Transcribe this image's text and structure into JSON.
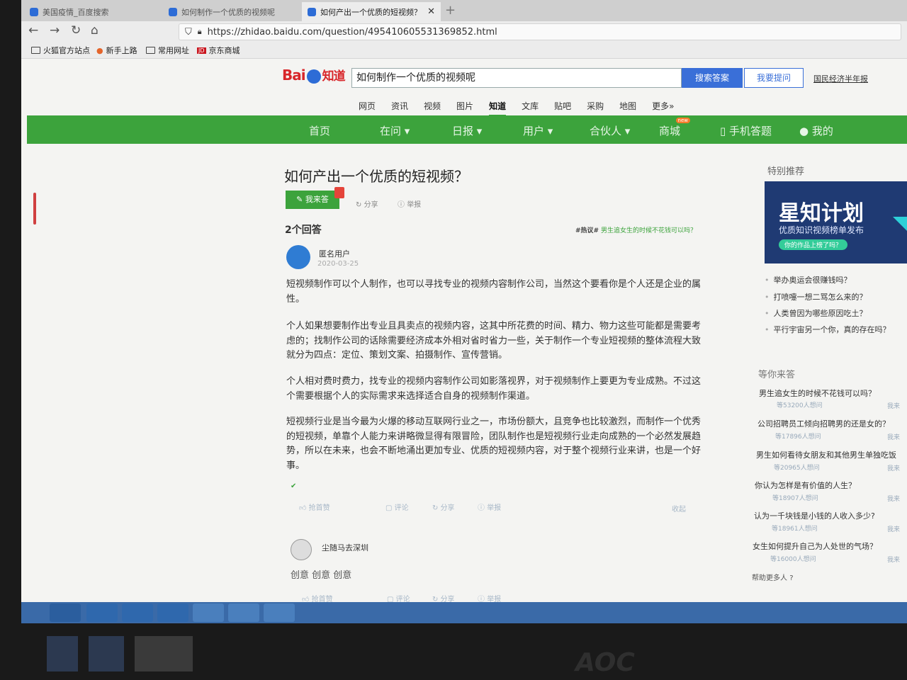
{
  "browser": {
    "tabs": [
      {
        "label": "美国疫情_百度搜索"
      },
      {
        "label": "如何制作一个优质的视频呢"
      },
      {
        "label": "如何产出一个优质的短视频？"
      }
    ],
    "new_tab": "+",
    "close_glyph": "✕",
    "url": "https://zhidao.baidu.com/question/495410605531369852.html",
    "bookmarks": [
      "火狐官方站点",
      "新手上路",
      "常用网址",
      "京东商城"
    ]
  },
  "header": {
    "logo": {
      "bai": "Bai",
      "du": "du",
      "zhidao": "知道"
    },
    "search_value": "如何制作一个优质的视频呢",
    "search_button": "搜索答案",
    "ask_button": "我要提问",
    "annual_link": "国民经济半年报",
    "categories": [
      "网页",
      "资讯",
      "视频",
      "图片",
      "知道",
      "文库",
      "贴吧",
      "采购",
      "地图",
      "更多»"
    ],
    "active_category": "知道"
  },
  "greennav": {
    "items": [
      "首页",
      "在问 ▾",
      "日报 ▾",
      "用户 ▾",
      "合伙人 ▾",
      "商城",
      "手机答题",
      "我的"
    ],
    "new_badge": "new"
  },
  "question": {
    "title": "如何产出一个优质的短视频？",
    "answer_button": "我来答",
    "share": "分享",
    "report": "举报",
    "answer_count": "2个回答",
    "hot_tag": "#热议#",
    "hot_question": "男生追女生的时候不花钱可以吗？"
  },
  "answer1": {
    "user": "匿名用户",
    "date": "2020-03-25",
    "paragraphs": [
      "短视频制作可以个人制作，也可以寻找专业的视频内容制作公司，当然这个要看你是个人还是企业的属性。",
      "个人如果想要制作出专业且具卖点的视频内容，这其中所花费的时间、精力、物力这些可能都是需要考虑的；找制作公司的话除需要经济成本外相对省时省力一些，关于制作一个专业短视频的整体流程大致就分为四点：定位、策划文案、拍摄制作、宣传营销。",
      "个人相对费时费力，找专业的视频内容制作公司如影落视界，对于视频制作上要更为专业成熟。不过这个需要根据个人的实际需求来选择适合自身的视频制作渠道。",
      "短视频行业是当今最为火爆的移动互联网行业之一，市场份额大，且竞争也比较激烈，而制作一个优秀的短视频，单靠个人能力来讲略微显得有限冒险，团队制作也是短视频行业走向成熟的一个必然发展趋势，所以在未来，也会不断地涌出更加专业、优质的短视频内容，对于整个视频行业来讲，也是一个好事。"
    ],
    "actions": [
      "抢首赞",
      "评论",
      "分享",
      "举报"
    ],
    "collect": "收起"
  },
  "answer2": {
    "user": "尘随马去深圳",
    "body": "创意 创意 创意",
    "actions": [
      "抢首赞",
      "评论",
      "分享",
      "举报"
    ]
  },
  "sidebar": {
    "title": "特别推荐",
    "banner": {
      "title": "星知计划",
      "subtitle": "优质知识视频榜单发布",
      "pill": "你的作品上榜了吗？"
    },
    "recommend": [
      "举办奥运会很赚钱吗？",
      "打喷嚏一想二骂怎么来的？",
      "人类曾因为哪些原因吃土？",
      "平行宇宙另一个你，真的存在吗？"
    ],
    "waiting_title": "等你来答",
    "waiting": [
      {
        "q": "男生追女生的时候不花钱可以吗？",
        "meta": "等53200人想问",
        "act": "我来"
      },
      {
        "q": "公司招聘员工倾向招聘男的还是女的？",
        "meta": "等17896人想问",
        "act": "我来"
      },
      {
        "q": "男生如何看待女朋友和其他男生单独吃饭",
        "meta": "等20965人想问",
        "act": "我来"
      },
      {
        "q": "你认为怎样是有价值的人生？",
        "meta": "等18907人想问",
        "act": "我来"
      },
      {
        "q": "认为一千块钱是小钱的人收入多少?",
        "meta": "等18961人想问",
        "act": "我来"
      },
      {
        "q": "女生如何提升自己为人处世的气场？",
        "meta": "等16000人想问",
        "act": "我来"
      }
    ],
    "help_more": "帮助更多人"
  },
  "monitor": {
    "brand": "AOC"
  }
}
